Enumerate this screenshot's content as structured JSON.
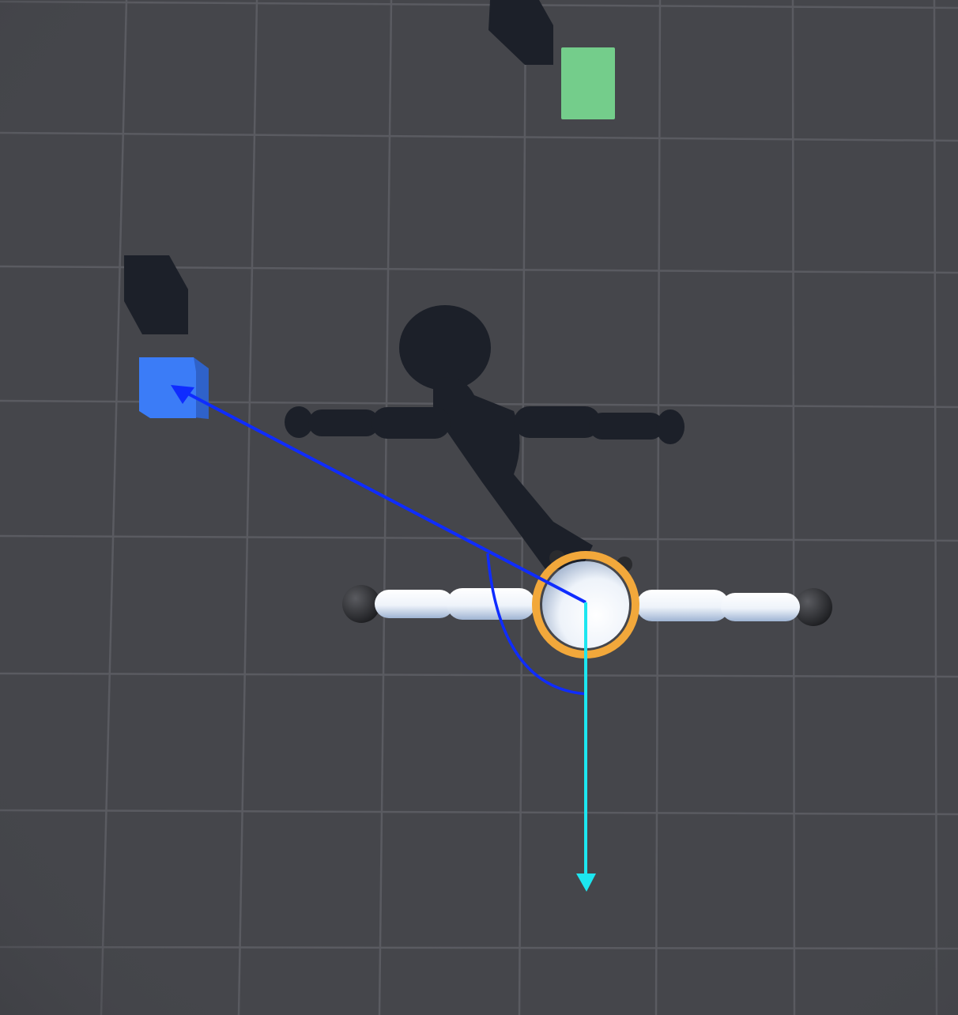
{
  "scene": {
    "background_color": "#45464b",
    "grid_color": "#5a5b61",
    "shadow_color": "#1c2029",
    "objects": {
      "target_blue": {
        "kind": "cube",
        "color": "#3b7cf7",
        "side_color": "#2f62c9"
      },
      "target_green": {
        "kind": "cube",
        "color": "#74cd8b"
      },
      "character": {
        "kind": "t-pose-mannequin",
        "body_color": "#e8eef7",
        "joint_color": "#2a2b2e",
        "selection_ring_color": "#f2a83b"
      }
    },
    "gizmos": {
      "direction_to_target": {
        "color": "#0f2cff",
        "icon": "arrow-icon"
      },
      "facing_direction": {
        "color": "#1de6f0",
        "icon": "arrow-icon"
      },
      "angle_arc": {
        "color": "#0f2cff",
        "icon": "arc-icon"
      }
    }
  }
}
